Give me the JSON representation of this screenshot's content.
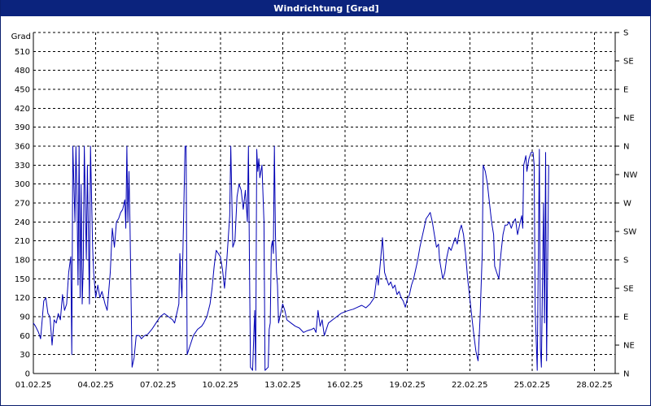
{
  "window": {
    "title": "Windrichtung [Grad]"
  },
  "colors": {
    "title_bar": "#0b237d",
    "line": "#0000b4",
    "grid": "#000000",
    "background": "#ffffff"
  },
  "chart_data": {
    "type": "line",
    "title": "Windrichtung [Grad]",
    "ylabel": "Grad",
    "xlabel": "",
    "grid": true,
    "ylim": [
      0,
      540
    ],
    "y_ticks": [
      0,
      30,
      60,
      90,
      120,
      150,
      180,
      210,
      240,
      270,
      300,
      330,
      360,
      390,
      420,
      450,
      480,
      510
    ],
    "y_right_labels": [
      "N",
      "NE",
      "E",
      "SE",
      "S",
      "SW",
      "W",
      "NW",
      "N",
      "NE",
      "E",
      "SE",
      "S"
    ],
    "x_range": [
      "01.02.25",
      "01.03.25"
    ],
    "x_ticks": [
      "01.02.25",
      "04.02.25",
      "07.02.25",
      "10.02.25",
      "13.02.25",
      "16.02.25",
      "19.02.25",
      "22.02.25",
      "25.02.25",
      "28.02.25"
    ],
    "series": [
      {
        "points": [
          [
            0.0,
            80
          ],
          [
            0.1,
            75
          ],
          [
            0.25,
            65
          ],
          [
            0.35,
            55
          ],
          [
            0.5,
            115
          ],
          [
            0.6,
            120
          ],
          [
            0.7,
            95
          ],
          [
            0.8,
            90
          ],
          [
            0.9,
            45
          ],
          [
            1.0,
            85
          ],
          [
            1.1,
            80
          ],
          [
            1.2,
            95
          ],
          [
            1.3,
            85
          ],
          [
            1.4,
            125
          ],
          [
            1.5,
            100
          ],
          [
            1.6,
            110
          ],
          [
            1.7,
            160
          ],
          [
            1.8,
            185
          ],
          [
            1.85,
            30
          ],
          [
            1.9,
            360
          ],
          [
            2.0,
            240
          ],
          [
            2.05,
            360
          ],
          [
            2.1,
            280
          ],
          [
            2.15,
            140
          ],
          [
            2.2,
            360
          ],
          [
            2.25,
            120
          ],
          [
            2.3,
            300
          ],
          [
            2.35,
            110
          ],
          [
            2.4,
            170
          ],
          [
            2.45,
            360
          ],
          [
            2.55,
            180
          ],
          [
            2.6,
            330
          ],
          [
            2.7,
            110
          ],
          [
            2.75,
            360
          ],
          [
            2.85,
            200
          ],
          [
            2.9,
            160
          ],
          [
            3.0,
            120
          ],
          [
            3.1,
            140
          ],
          [
            3.2,
            120
          ],
          [
            3.3,
            130
          ],
          [
            3.45,
            110
          ],
          [
            3.55,
            100
          ],
          [
            3.7,
            160
          ],
          [
            3.8,
            230
          ],
          [
            3.9,
            200
          ],
          [
            4.0,
            240
          ],
          [
            4.1,
            245
          ],
          [
            4.2,
            255
          ],
          [
            4.3,
            260
          ],
          [
            4.4,
            275
          ],
          [
            4.45,
            230
          ],
          [
            4.5,
            360
          ],
          [
            4.55,
            240
          ],
          [
            4.6,
            320
          ],
          [
            4.65,
            240
          ],
          [
            4.75,
            10
          ],
          [
            4.85,
            25
          ],
          [
            4.95,
            60
          ],
          [
            5.1,
            60
          ],
          [
            5.2,
            55
          ],
          [
            5.35,
            60
          ],
          [
            5.5,
            62
          ],
          [
            5.7,
            70
          ],
          [
            5.9,
            80
          ],
          [
            6.1,
            90
          ],
          [
            6.3,
            95
          ],
          [
            6.5,
            90
          ],
          [
            6.7,
            85
          ],
          [
            6.8,
            80
          ],
          [
            6.9,
            95
          ],
          [
            7.0,
            110
          ],
          [
            7.05,
            190
          ],
          [
            7.1,
            150
          ],
          [
            7.15,
            120
          ],
          [
            7.2,
            200
          ],
          [
            7.3,
            360
          ],
          [
            7.35,
            360
          ],
          [
            7.4,
            30
          ],
          [
            7.5,
            40
          ],
          [
            7.7,
            60
          ],
          [
            7.9,
            70
          ],
          [
            8.1,
            75
          ],
          [
            8.2,
            80
          ],
          [
            8.35,
            90
          ],
          [
            8.5,
            110
          ],
          [
            8.6,
            135
          ],
          [
            8.7,
            170
          ],
          [
            8.8,
            195
          ],
          [
            9.0,
            185
          ],
          [
            9.1,
            165
          ],
          [
            9.2,
            135
          ],
          [
            9.3,
            175
          ],
          [
            9.45,
            250
          ],
          [
            9.5,
            360
          ],
          [
            9.6,
            200
          ],
          [
            9.7,
            210
          ],
          [
            9.8,
            280
          ],
          [
            9.9,
            300
          ],
          [
            10.0,
            290
          ],
          [
            10.1,
            260
          ],
          [
            10.2,
            290
          ],
          [
            10.3,
            240
          ],
          [
            10.35,
            360
          ],
          [
            10.4,
            170
          ],
          [
            10.45,
            10
          ],
          [
            10.55,
            5
          ],
          [
            10.65,
            100
          ],
          [
            10.7,
            5
          ],
          [
            10.75,
            355
          ],
          [
            10.8,
            320
          ],
          [
            10.85,
            340
          ],
          [
            10.9,
            310
          ],
          [
            11.0,
            330
          ],
          [
            11.1,
            240
          ],
          [
            11.15,
            5
          ],
          [
            11.3,
            10
          ],
          [
            11.35,
            70
          ],
          [
            11.4,
            80
          ],
          [
            11.45,
            200
          ],
          [
            11.5,
            210
          ],
          [
            11.55,
            190
          ],
          [
            11.6,
            360
          ],
          [
            11.65,
            220
          ],
          [
            11.7,
            160
          ],
          [
            11.75,
            140
          ],
          [
            11.8,
            80
          ],
          [
            11.9,
            95
          ],
          [
            12.0,
            110
          ],
          [
            12.1,
            100
          ],
          [
            12.2,
            85
          ],
          [
            12.4,
            80
          ],
          [
            12.6,
            75
          ],
          [
            12.8,
            72
          ],
          [
            13.0,
            65
          ],
          [
            13.2,
            68
          ],
          [
            13.4,
            70
          ],
          [
            13.5,
            72
          ],
          [
            13.6,
            65
          ],
          [
            13.7,
            100
          ],
          [
            13.8,
            75
          ],
          [
            13.9,
            85
          ],
          [
            14.0,
            60
          ],
          [
            14.2,
            80
          ],
          [
            14.4,
            85
          ],
          [
            14.6,
            90
          ],
          [
            14.8,
            95
          ],
          [
            15.0,
            98
          ],
          [
            15.2,
            100
          ],
          [
            15.4,
            102
          ],
          [
            15.6,
            105
          ],
          [
            15.8,
            108
          ],
          [
            16.0,
            104
          ],
          [
            16.2,
            110
          ],
          [
            16.4,
            120
          ],
          [
            16.5,
            145
          ],
          [
            16.55,
            155
          ],
          [
            16.6,
            140
          ],
          [
            16.7,
            175
          ],
          [
            16.8,
            215
          ],
          [
            16.9,
            160
          ],
          [
            17.0,
            150
          ],
          [
            17.1,
            140
          ],
          [
            17.2,
            145
          ],
          [
            17.3,
            135
          ],
          [
            17.4,
            140
          ],
          [
            17.5,
            125
          ],
          [
            17.6,
            130
          ],
          [
            17.7,
            120
          ],
          [
            17.8,
            115
          ],
          [
            17.9,
            105
          ],
          [
            18.0,
            118
          ],
          [
            18.1,
            125
          ],
          [
            18.2,
            140
          ],
          [
            18.3,
            150
          ],
          [
            18.5,
            180
          ],
          [
            18.6,
            200
          ],
          [
            18.7,
            215
          ],
          [
            18.8,
            230
          ],
          [
            18.9,
            245
          ],
          [
            19.0,
            250
          ],
          [
            19.1,
            255
          ],
          [
            19.2,
            240
          ],
          [
            19.3,
            220
          ],
          [
            19.4,
            200
          ],
          [
            19.5,
            205
          ],
          [
            19.55,
            180
          ],
          [
            19.6,
            170
          ],
          [
            19.7,
            150
          ],
          [
            19.8,
            160
          ],
          [
            19.9,
            185
          ],
          [
            20.0,
            200
          ],
          [
            20.1,
            195
          ],
          [
            20.2,
            205
          ],
          [
            20.3,
            215
          ],
          [
            20.4,
            205
          ],
          [
            20.5,
            225
          ],
          [
            20.6,
            235
          ],
          [
            20.7,
            220
          ],
          [
            20.8,
            190
          ],
          [
            20.9,
            150
          ],
          [
            21.0,
            120
          ],
          [
            21.1,
            90
          ],
          [
            21.2,
            60
          ],
          [
            21.3,
            35
          ],
          [
            21.4,
            20
          ],
          [
            21.5,
            90
          ],
          [
            21.6,
            190
          ],
          [
            21.65,
            330
          ],
          [
            21.75,
            320
          ],
          [
            21.85,
            300
          ],
          [
            21.95,
            270
          ],
          [
            22.05,
            240
          ],
          [
            22.15,
            220
          ],
          [
            22.2,
            170
          ],
          [
            22.3,
            160
          ],
          [
            22.4,
            150
          ],
          [
            22.5,
            190
          ],
          [
            22.6,
            220
          ],
          [
            22.7,
            235
          ],
          [
            22.8,
            235
          ],
          [
            22.9,
            240
          ],
          [
            23.0,
            230
          ],
          [
            23.1,
            240
          ],
          [
            23.2,
            245
          ],
          [
            23.3,
            220
          ],
          [
            23.4,
            235
          ],
          [
            23.5,
            250
          ],
          [
            23.55,
            230
          ],
          [
            23.6,
            330
          ],
          [
            23.7,
            345
          ],
          [
            23.75,
            320
          ],
          [
            23.85,
            340
          ],
          [
            23.95,
            350
          ],
          [
            24.05,
            350
          ],
          [
            24.1,
            330
          ],
          [
            24.15,
            100
          ],
          [
            24.25,
            5
          ],
          [
            24.35,
            355
          ],
          [
            24.4,
            40
          ],
          [
            24.45,
            10
          ],
          [
            24.55,
            270
          ],
          [
            24.6,
            80
          ],
          [
            24.65,
            350
          ],
          [
            24.7,
            20
          ],
          [
            24.8,
            330
          ]
        ]
      }
    ]
  }
}
